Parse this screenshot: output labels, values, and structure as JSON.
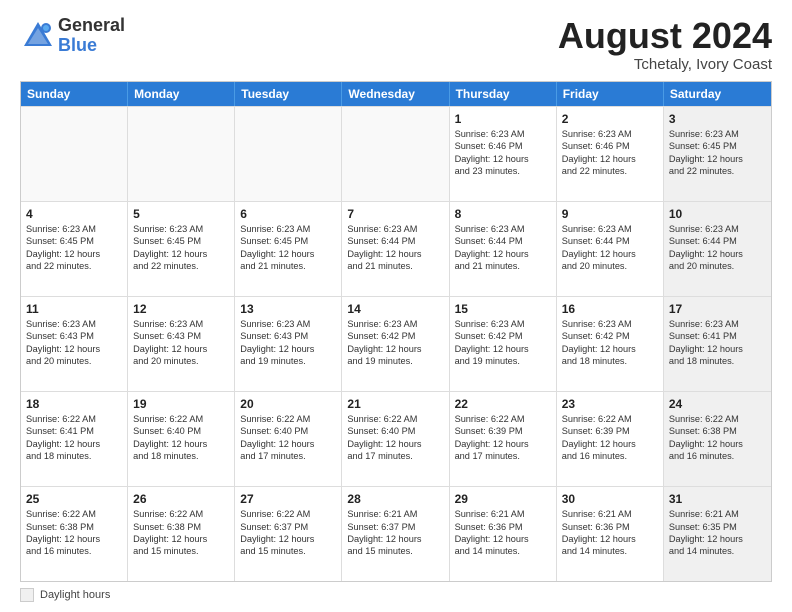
{
  "header": {
    "logo_general": "General",
    "logo_blue": "Blue",
    "title": "August 2024",
    "location": "Tchetaly, Ivory Coast"
  },
  "days_of_week": [
    "Sunday",
    "Monday",
    "Tuesday",
    "Wednesday",
    "Thursday",
    "Friday",
    "Saturday"
  ],
  "legend": {
    "label": "Daylight hours"
  },
  "weeks": [
    [
      {
        "day": "",
        "empty": true
      },
      {
        "day": "",
        "empty": true
      },
      {
        "day": "",
        "empty": true
      },
      {
        "day": "",
        "empty": true
      },
      {
        "day": "1",
        "line1": "Sunrise: 6:23 AM",
        "line2": "Sunset: 6:46 PM",
        "line3": "Daylight: 12 hours",
        "line4": "and 23 minutes."
      },
      {
        "day": "2",
        "line1": "Sunrise: 6:23 AM",
        "line2": "Sunset: 6:46 PM",
        "line3": "Daylight: 12 hours",
        "line4": "and 22 minutes."
      },
      {
        "day": "3",
        "line1": "Sunrise: 6:23 AM",
        "line2": "Sunset: 6:45 PM",
        "line3": "Daylight: 12 hours",
        "line4": "and 22 minutes.",
        "shaded": true
      }
    ],
    [
      {
        "day": "4",
        "line1": "Sunrise: 6:23 AM",
        "line2": "Sunset: 6:45 PM",
        "line3": "Daylight: 12 hours",
        "line4": "and 22 minutes."
      },
      {
        "day": "5",
        "line1": "Sunrise: 6:23 AM",
        "line2": "Sunset: 6:45 PM",
        "line3": "Daylight: 12 hours",
        "line4": "and 22 minutes."
      },
      {
        "day": "6",
        "line1": "Sunrise: 6:23 AM",
        "line2": "Sunset: 6:45 PM",
        "line3": "Daylight: 12 hours",
        "line4": "and 21 minutes."
      },
      {
        "day": "7",
        "line1": "Sunrise: 6:23 AM",
        "line2": "Sunset: 6:44 PM",
        "line3": "Daylight: 12 hours",
        "line4": "and 21 minutes."
      },
      {
        "day": "8",
        "line1": "Sunrise: 6:23 AM",
        "line2": "Sunset: 6:44 PM",
        "line3": "Daylight: 12 hours",
        "line4": "and 21 minutes."
      },
      {
        "day": "9",
        "line1": "Sunrise: 6:23 AM",
        "line2": "Sunset: 6:44 PM",
        "line3": "Daylight: 12 hours",
        "line4": "and 20 minutes."
      },
      {
        "day": "10",
        "line1": "Sunrise: 6:23 AM",
        "line2": "Sunset: 6:44 PM",
        "line3": "Daylight: 12 hours",
        "line4": "and 20 minutes.",
        "shaded": true
      }
    ],
    [
      {
        "day": "11",
        "line1": "Sunrise: 6:23 AM",
        "line2": "Sunset: 6:43 PM",
        "line3": "Daylight: 12 hours",
        "line4": "and 20 minutes."
      },
      {
        "day": "12",
        "line1": "Sunrise: 6:23 AM",
        "line2": "Sunset: 6:43 PM",
        "line3": "Daylight: 12 hours",
        "line4": "and 20 minutes."
      },
      {
        "day": "13",
        "line1": "Sunrise: 6:23 AM",
        "line2": "Sunset: 6:43 PM",
        "line3": "Daylight: 12 hours",
        "line4": "and 19 minutes."
      },
      {
        "day": "14",
        "line1": "Sunrise: 6:23 AM",
        "line2": "Sunset: 6:42 PM",
        "line3": "Daylight: 12 hours",
        "line4": "and 19 minutes."
      },
      {
        "day": "15",
        "line1": "Sunrise: 6:23 AM",
        "line2": "Sunset: 6:42 PM",
        "line3": "Daylight: 12 hours",
        "line4": "and 19 minutes."
      },
      {
        "day": "16",
        "line1": "Sunrise: 6:23 AM",
        "line2": "Sunset: 6:42 PM",
        "line3": "Daylight: 12 hours",
        "line4": "and 18 minutes."
      },
      {
        "day": "17",
        "line1": "Sunrise: 6:23 AM",
        "line2": "Sunset: 6:41 PM",
        "line3": "Daylight: 12 hours",
        "line4": "and 18 minutes.",
        "shaded": true
      }
    ],
    [
      {
        "day": "18",
        "line1": "Sunrise: 6:22 AM",
        "line2": "Sunset: 6:41 PM",
        "line3": "Daylight: 12 hours",
        "line4": "and 18 minutes."
      },
      {
        "day": "19",
        "line1": "Sunrise: 6:22 AM",
        "line2": "Sunset: 6:40 PM",
        "line3": "Daylight: 12 hours",
        "line4": "and 18 minutes."
      },
      {
        "day": "20",
        "line1": "Sunrise: 6:22 AM",
        "line2": "Sunset: 6:40 PM",
        "line3": "Daylight: 12 hours",
        "line4": "and 17 minutes."
      },
      {
        "day": "21",
        "line1": "Sunrise: 6:22 AM",
        "line2": "Sunset: 6:40 PM",
        "line3": "Daylight: 12 hours",
        "line4": "and 17 minutes."
      },
      {
        "day": "22",
        "line1": "Sunrise: 6:22 AM",
        "line2": "Sunset: 6:39 PM",
        "line3": "Daylight: 12 hours",
        "line4": "and 17 minutes."
      },
      {
        "day": "23",
        "line1": "Sunrise: 6:22 AM",
        "line2": "Sunset: 6:39 PM",
        "line3": "Daylight: 12 hours",
        "line4": "and 16 minutes."
      },
      {
        "day": "24",
        "line1": "Sunrise: 6:22 AM",
        "line2": "Sunset: 6:38 PM",
        "line3": "Daylight: 12 hours",
        "line4": "and 16 minutes.",
        "shaded": true
      }
    ],
    [
      {
        "day": "25",
        "line1": "Sunrise: 6:22 AM",
        "line2": "Sunset: 6:38 PM",
        "line3": "Daylight: 12 hours",
        "line4": "and 16 minutes."
      },
      {
        "day": "26",
        "line1": "Sunrise: 6:22 AM",
        "line2": "Sunset: 6:38 PM",
        "line3": "Daylight: 12 hours",
        "line4": "and 15 minutes."
      },
      {
        "day": "27",
        "line1": "Sunrise: 6:22 AM",
        "line2": "Sunset: 6:37 PM",
        "line3": "Daylight: 12 hours",
        "line4": "and 15 minutes."
      },
      {
        "day": "28",
        "line1": "Sunrise: 6:21 AM",
        "line2": "Sunset: 6:37 PM",
        "line3": "Daylight: 12 hours",
        "line4": "and 15 minutes."
      },
      {
        "day": "29",
        "line1": "Sunrise: 6:21 AM",
        "line2": "Sunset: 6:36 PM",
        "line3": "Daylight: 12 hours",
        "line4": "and 14 minutes."
      },
      {
        "day": "30",
        "line1": "Sunrise: 6:21 AM",
        "line2": "Sunset: 6:36 PM",
        "line3": "Daylight: 12 hours",
        "line4": "and 14 minutes."
      },
      {
        "day": "31",
        "line1": "Sunrise: 6:21 AM",
        "line2": "Sunset: 6:35 PM",
        "line3": "Daylight: 12 hours",
        "line4": "and 14 minutes.",
        "shaded": true
      }
    ]
  ]
}
